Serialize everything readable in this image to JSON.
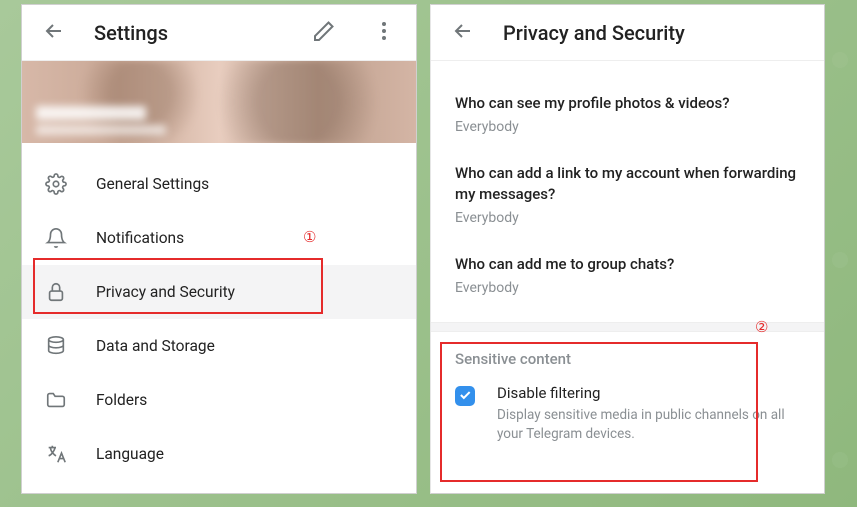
{
  "left": {
    "title": "Settings",
    "menu": [
      {
        "icon": "gear",
        "label": "General Settings"
      },
      {
        "icon": "bell",
        "label": "Notifications"
      },
      {
        "icon": "lock",
        "label": "Privacy and Security"
      },
      {
        "icon": "storage",
        "label": "Data and Storage"
      },
      {
        "icon": "folder",
        "label": "Folders"
      },
      {
        "icon": "language",
        "label": "Language"
      }
    ]
  },
  "right": {
    "title": "Privacy and Security",
    "items": [
      {
        "q": "Who can see my profile photos & videos?",
        "v": "Everybody"
      },
      {
        "q": "Who can add a link to my account when forwarding my messages?",
        "v": "Everybody"
      },
      {
        "q": "Who can add me to group chats?",
        "v": "Everybody"
      }
    ],
    "section": {
      "title": "Sensitive content",
      "checkbox": {
        "checked": true,
        "label": "Disable filtering",
        "sub": "Display sensitive media in public channels on all your Telegram devices."
      }
    }
  },
  "annotations": {
    "one": "①",
    "two": "②"
  }
}
